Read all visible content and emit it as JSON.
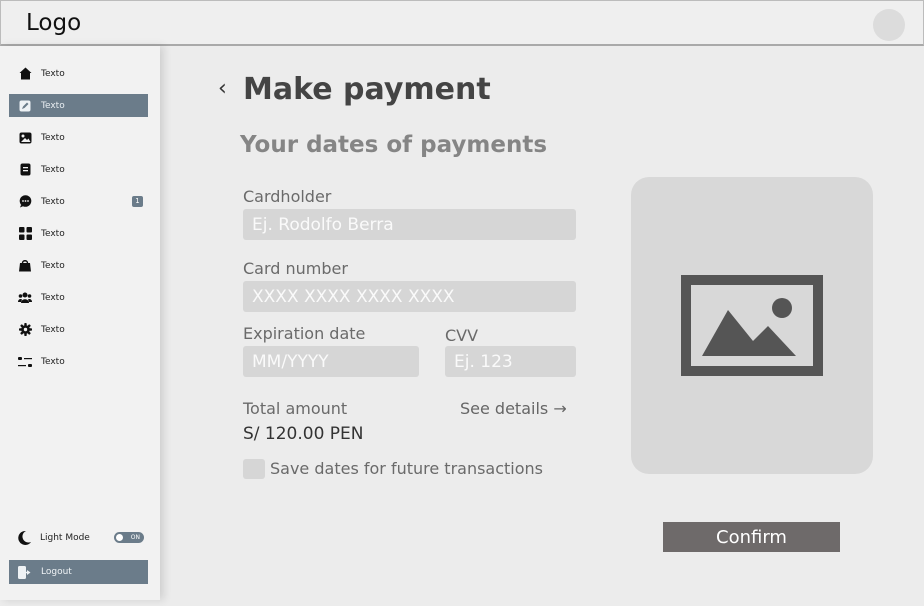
{
  "header": {
    "logo": "Logo"
  },
  "sidebar": {
    "items": [
      {
        "label": "Texto",
        "icon": "home-icon"
      },
      {
        "label": "Texto",
        "icon": "edit-icon",
        "active": true
      },
      {
        "label": "Texto",
        "icon": "image-icon"
      },
      {
        "label": "Texto",
        "icon": "document-icon"
      },
      {
        "label": "Texto",
        "icon": "chat-icon",
        "badge": "1"
      },
      {
        "label": "Texto",
        "icon": "grid-icon"
      },
      {
        "label": "Texto",
        "icon": "bag-icon"
      },
      {
        "label": "Texto",
        "icon": "users-icon"
      },
      {
        "label": "Texto",
        "icon": "gear-icon"
      },
      {
        "label": "Texto",
        "icon": "sliders-icon"
      }
    ],
    "mode": {
      "label": "Light Mode",
      "toggle": "ON"
    },
    "logout": "Logout"
  },
  "main": {
    "back": "‹",
    "title": "Make payment",
    "subtitle": "Your dates of payments",
    "cardholder": {
      "label": "Cardholder",
      "placeholder": "Ej. Rodolfo Berra"
    },
    "card_number": {
      "label": "Card number",
      "placeholder": "XXXX XXXX XXXX XXXX"
    },
    "expiration": {
      "label": "Expiration date",
      "placeholder": "MM/YYYY"
    },
    "cvv": {
      "label": "CVV",
      "placeholder": "Ej. 123"
    },
    "total_label": "Total amount",
    "total_value": "S/ 120.00 PEN",
    "see_details": "See details →",
    "save_label": "Save dates for future transactions",
    "confirm": "Confirm"
  },
  "colors": {
    "accent": "#6b7c8a",
    "button": "#6e6a6a"
  }
}
